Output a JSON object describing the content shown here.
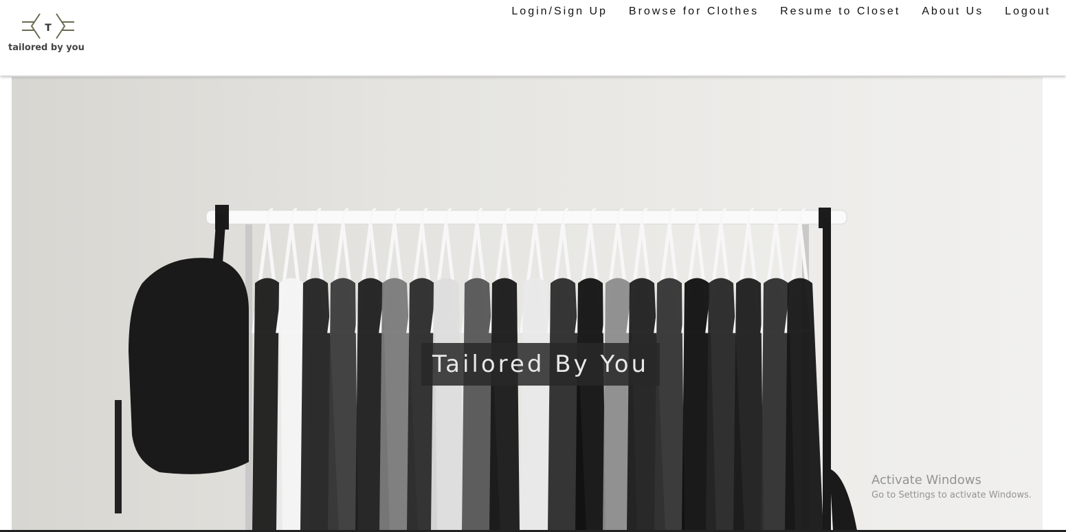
{
  "brand": {
    "logo_letter": "T",
    "logo_text": "tailored by you"
  },
  "nav": {
    "items": [
      {
        "label": "Login/Sign Up"
      },
      {
        "label": "Browse for Clothes"
      },
      {
        "label": "Resume to Closet"
      },
      {
        "label": "About Us"
      },
      {
        "label": "Logout"
      }
    ]
  },
  "hero": {
    "title": "Tailored By You"
  },
  "os_watermark": {
    "title": "Activate Windows",
    "subtitle": "Go to Settings to activate Windows."
  }
}
